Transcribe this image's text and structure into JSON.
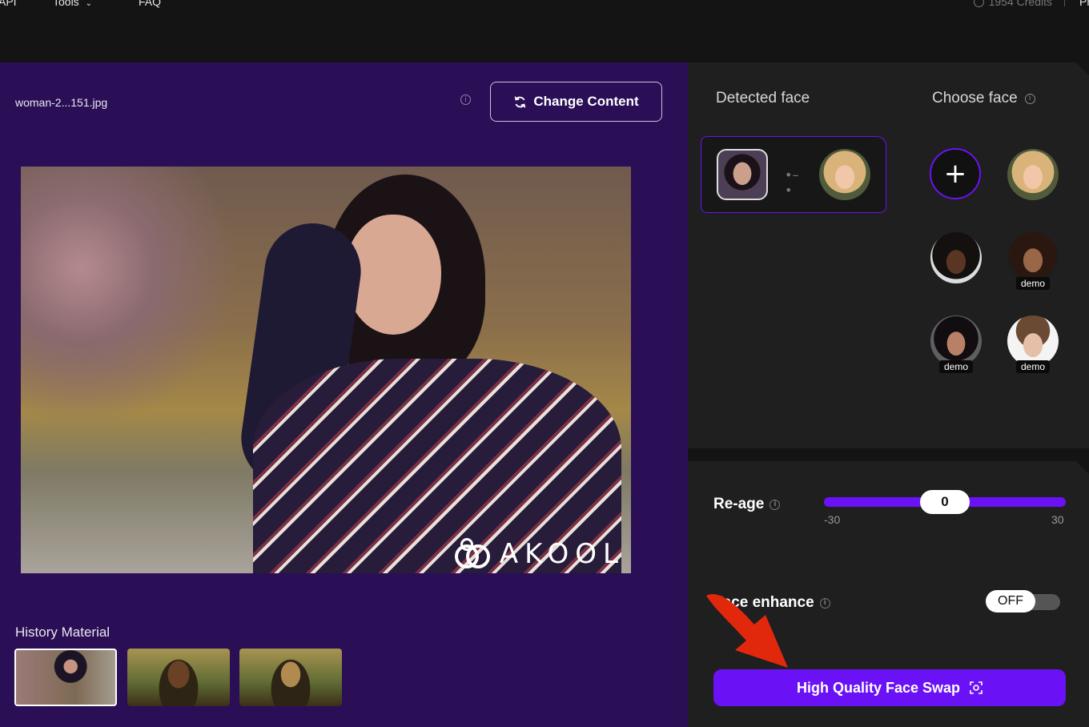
{
  "nav": {
    "api_label": "API",
    "tools_label": "Tools",
    "faq_label": "FAQ",
    "credits_label": "1954 Credits",
    "cut_label": "Pr"
  },
  "workspace": {
    "filename": "woman-2...151.jpg",
    "change_content_label": "Change Content",
    "logo_text": "AKOOL",
    "history_label": "History Material"
  },
  "faces": {
    "detected_label": "Detected face",
    "choose_label": "Choose face",
    "demo_tag": "demo"
  },
  "settings": {
    "reage_label": "Re-age",
    "reage_value": "0",
    "reage_min": "-30",
    "reage_max": "30",
    "enhance_label": "Face enhance",
    "enhance_state": "OFF",
    "swap_button_label": "High Quality Face Swap"
  },
  "colors": {
    "accent": "#6a12f5",
    "left_panel_bg": "#2a0f57",
    "right_panel_bg": "#1f1f1f",
    "annotation_arrow": "#e2280c"
  }
}
